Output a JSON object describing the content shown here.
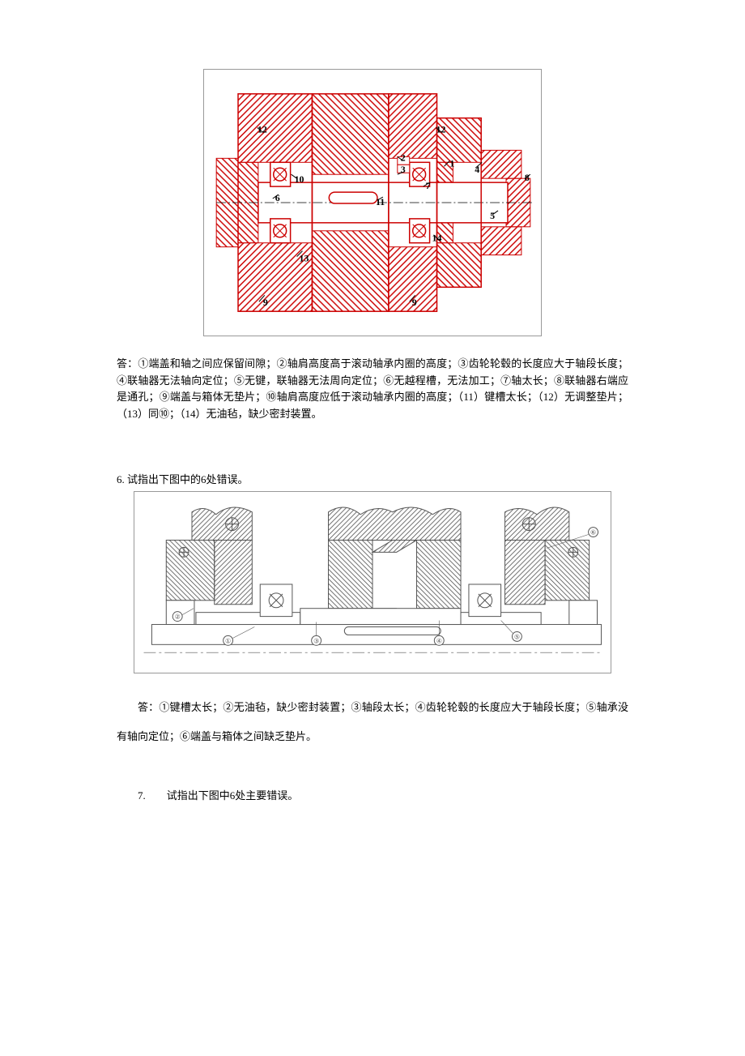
{
  "answer5": "答：①端盖和轴之间应保留间隙；②轴肩高度高于滚动轴承内圈的高度；③齿轮轮毂的长度应大于轴段长度；④联轴器无法轴向定位；⑤无键，联轴器无法周向定位；⑥无越程槽，无法加工；⑦轴太长；⑧联轴器右端应是通孔；⑨端盖与箱体无垫片；⑩轴肩高度应低于滚动轴承内圈的高度；（11）键槽太长；（12）无调整垫片；（13）同⑩；（14）无油毡，缺少密封装置。",
  "question6": "6. 试指出下图中的6处错误。",
  "answer6": "答：①键槽太长；②无油毡，缺少密封装置；③轴段太长；④齿轮轮毂的长度应大于轴段长度；⑤轴承没有轴向定位；⑥端盖与箱体之间缺乏垫片。",
  "question7": "7.　　试指出下图中6处主要错误。",
  "fig1_labels": {
    "1": "1",
    "2": "2",
    "3": "3",
    "4": "4",
    "5": "5",
    "6": "6",
    "7": "7",
    "8": "8",
    "9": "9",
    "10": "10",
    "11": "11",
    "12": "12",
    "13": "13",
    "14": "14"
  },
  "fig2_labels": {
    "1": "①",
    "2": "②",
    "3": "③",
    "4": "④",
    "5": "⑤",
    "6": "⑥"
  }
}
